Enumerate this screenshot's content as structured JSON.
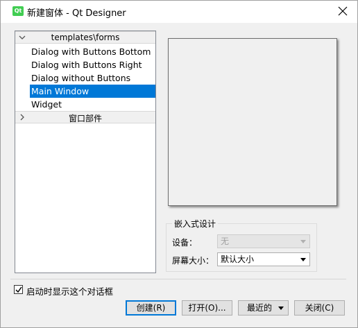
{
  "window": {
    "title": "新建窗体 - Qt Designer",
    "app_icon_text": "Qt"
  },
  "templates": {
    "section_templates": "templates\\forms",
    "items": [
      {
        "label": "Dialog with Buttons Bottom",
        "selected": false
      },
      {
        "label": "Dialog with Buttons Right",
        "selected": false
      },
      {
        "label": "Dialog without Buttons",
        "selected": false
      },
      {
        "label": "Main Window",
        "selected": true
      },
      {
        "label": "Widget",
        "selected": false
      }
    ],
    "section_widgets": "窗口部件"
  },
  "embedded_design": {
    "group_title": "嵌入式设计",
    "device_label": "设备：",
    "device_value": "无",
    "screen_size_label": "屏幕大小：",
    "screen_size_value": "默认大小"
  },
  "footer": {
    "show_on_startup_label": "启动时显示这个对话框",
    "show_on_startup_checked": true,
    "create_button": "创建(R)",
    "open_button": "打开(O)...",
    "recent_button": "最近的",
    "close_button": "关闭(C)"
  },
  "colors": {
    "selection": "#0078d7",
    "qt_green": "#41cd52"
  }
}
